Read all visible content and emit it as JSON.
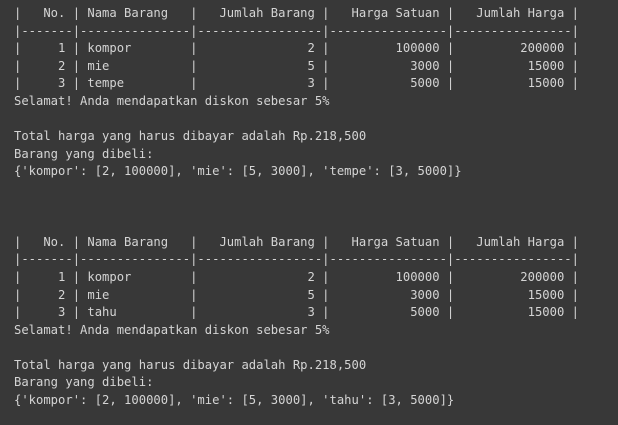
{
  "output": {
    "blocks": [
      {
        "lines": [
          "|   No. | Nama Barang   |   Jumlah Barang |   Harga Satuan |   Jumlah Harga |",
          "|-------|---------------|-----------------|----------------|----------------|",
          "|     1 | kompor        |               2 |         100000 |         200000 |",
          "|     2 | mie           |               5 |           3000 |          15000 |",
          "|     3 | tempe         |               3 |           5000 |          15000 |",
          "Selamat! Anda mendapatkan diskon sebesar 5%",
          "",
          "Total harga yang harus dibayar adalah Rp.218,500",
          "Barang yang dibeli:",
          "{'kompor': [2, 100000], 'mie': [5, 3000], 'tempe': [3, 5000]}",
          "",
          "",
          ""
        ]
      },
      {
        "lines": [
          "|   No. | Nama Barang   |   Jumlah Barang |   Harga Satuan |   Jumlah Harga |",
          "|-------|---------------|-----------------|----------------|----------------|",
          "|     1 | kompor        |               2 |         100000 |         200000 |",
          "|     2 | mie           |               5 |           3000 |          15000 |",
          "|     3 | tahu          |               3 |           5000 |          15000 |",
          "Selamat! Anda mendapatkan diskon sebesar 5%",
          "",
          "Total harga yang harus dibayar adalah Rp.218,500",
          "Barang yang dibeli:",
          "{'kompor': [2, 100000], 'mie': [5, 3000], 'tahu': [3, 5000]}"
        ]
      }
    ]
  }
}
